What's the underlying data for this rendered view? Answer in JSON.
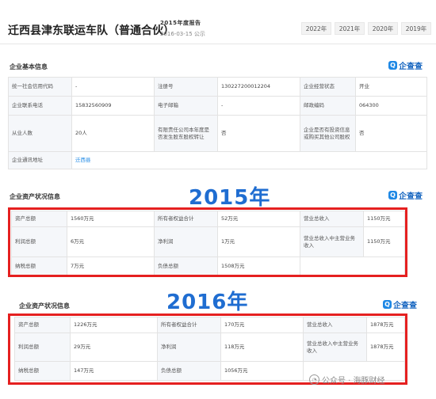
{
  "header": {
    "company_name": "迁西县津东联运车队（普通合伙）",
    "report_title": "2015年度报告",
    "report_date": "2016-03-15 公示",
    "years": [
      "2022年",
      "2021年",
      "2020年",
      "2019年"
    ]
  },
  "basic_info": {
    "title": "企业基本信息",
    "brand": "企查查",
    "rows": [
      [
        "统一社会信用代码",
        "-",
        "注册号",
        "130227200012204",
        "企业经营状态",
        "开业"
      ],
      [
        "企业联系电话",
        "15832560909",
        "电子邮箱",
        "-",
        "邮政编码",
        "064300"
      ],
      [
        "从业人数",
        "20人",
        "有限责任公司本年度是否发生股东股权转让",
        "否",
        "企业是否有投资信息或购买其他公司股权",
        "否"
      ],
      [
        "企业通讯地址",
        "迁西县",
        "",
        "",
        "",
        ""
      ]
    ]
  },
  "assets_2015": {
    "title": "企业资产状况信息",
    "brand": "企查查",
    "year_label": "2015年",
    "rows": [
      [
        "资产总额",
        "1560万元",
        "所有者权益合计",
        "52万元",
        "营业总收入",
        "1150万元"
      ],
      [
        "利润总额",
        "6万元",
        "净利润",
        "1万元",
        "营业总收入中主营业务收入",
        "1150万元"
      ],
      [
        "纳税总额",
        "7万元",
        "负债总额",
        "1508万元",
        "",
        ""
      ]
    ]
  },
  "assets_2016": {
    "title": "企业资产状况信息",
    "brand": "企查查",
    "year_label": "2016年",
    "rows": [
      [
        "资产总额",
        "1226万元",
        "所有者权益合计",
        "170万元",
        "营业总收入",
        "1878万元"
      ],
      [
        "利润总额",
        "29万元",
        "净利润",
        "118万元",
        "营业总收入中主营业务收入",
        "1878万元"
      ],
      [
        "纳税总额",
        "147万元",
        "负债总额",
        "1056万元",
        "",
        ""
      ]
    ]
  },
  "watermark": {
    "text": "公众号 · 海豚财经",
    "icon": "wechat-icon"
  },
  "colors": {
    "highlight_border": "#e52020",
    "year_label": "#1f6dd1",
    "brand": "#1565c0"
  }
}
